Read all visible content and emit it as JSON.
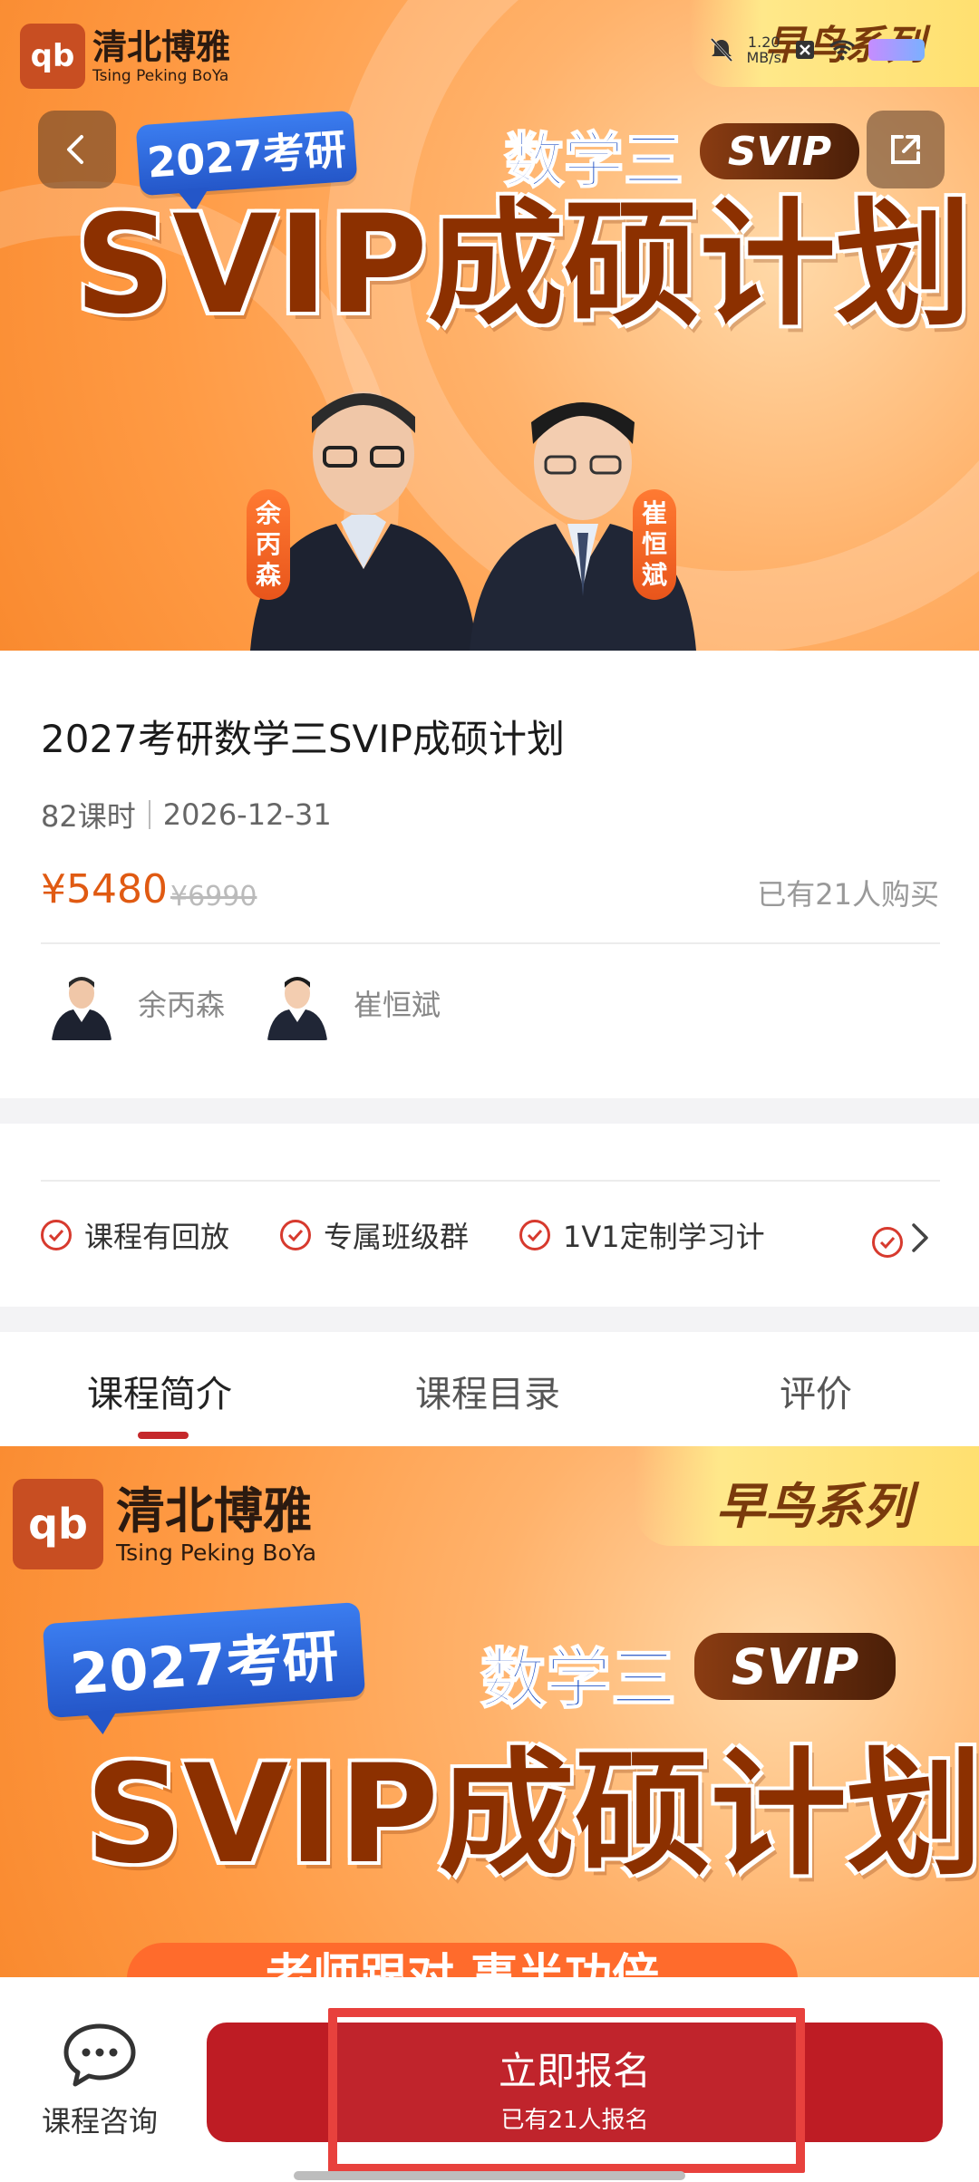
{
  "hero": {
    "logo_mark": "qb",
    "logo_cn": "清北博雅",
    "logo_en": "Tsing Peking BoYa",
    "early_bird": "早鸟系列",
    "tag_year": "2027考研",
    "subject": "数学三",
    "svip": "SVIP",
    "title": "SVIP成硕计划",
    "teacher_left": "余丙森",
    "teacher_right": "崔恒斌",
    "status_speed": "1.20\nMB/s",
    "back_icon": "chevron-left-icon",
    "share_icon": "share-icon"
  },
  "course": {
    "title": "2027考研数学三SVIP成硕计划",
    "lessons": "82课时",
    "deadline": "2026-12-31",
    "price": "¥5480",
    "original_price": "¥6990",
    "bought": "已有21人购买"
  },
  "teachers": [
    {
      "name": "余丙森"
    },
    {
      "name": "崔恒斌"
    }
  ],
  "features": [
    {
      "label": "课程有回放"
    },
    {
      "label": "专属班级群"
    },
    {
      "label": "1V1定制学习计"
    }
  ],
  "tabs": [
    {
      "label": "课程简介",
      "active": true
    },
    {
      "label": "课程目录",
      "active": false
    },
    {
      "label": "评价",
      "active": false
    }
  ],
  "hero2": {
    "logo_cn": "清北博雅",
    "logo_en": "Tsing Peking BoYa",
    "early_bird": "早鸟系列",
    "tag_year": "2027考研",
    "subject": "数学三",
    "svip": "SVIP",
    "title": "SVIP成硕计划",
    "cut_text": "老师跟对 事半功倍"
  },
  "bottom": {
    "consult_label": "课程咨询",
    "signup_label": "立即报名",
    "signup_sub": "已有21人报名"
  },
  "colors": {
    "accent_red": "#be1c24",
    "price_orange": "#e05a12",
    "banner_orange": "#ff9b45"
  }
}
